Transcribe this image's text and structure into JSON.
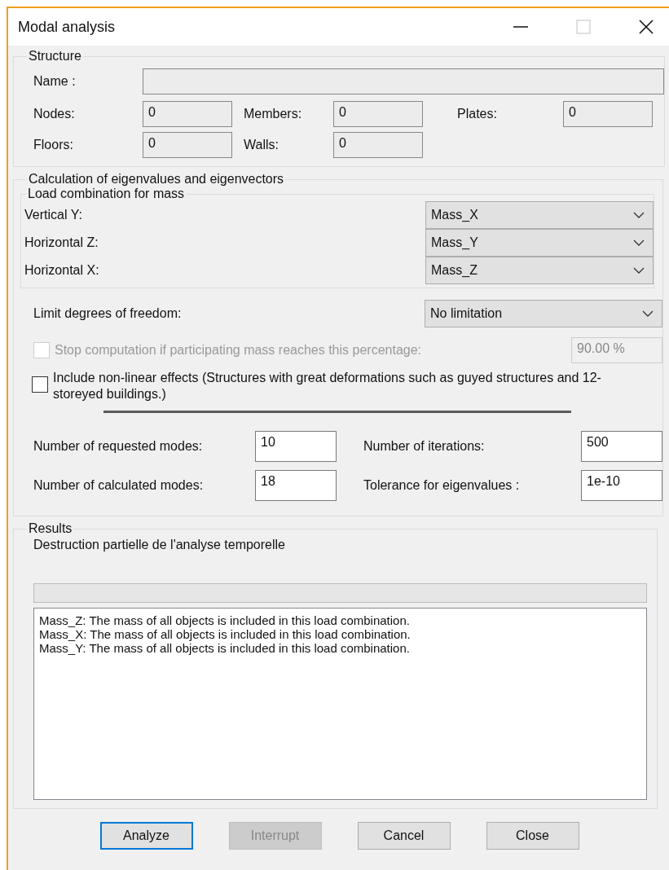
{
  "window": {
    "title": "Modal analysis"
  },
  "structure": {
    "title": "Structure",
    "name": {
      "label": "Name :"
    },
    "counts": [
      {
        "label": "Nodes:",
        "value": "0"
      },
      {
        "label": "Members:",
        "value": "0"
      },
      {
        "label": "Plates:",
        "value": "0"
      },
      {
        "label": "Floors:",
        "value": "0"
      },
      {
        "label": "Walls:",
        "value": "0"
      }
    ]
  },
  "calculation": {
    "title": "Calculation of eigenvalues and eigenvectors",
    "mass": {
      "title": "Load combination for mass",
      "rows": [
        {
          "label": "Vertical Y:",
          "value": "Mass_X"
        },
        {
          "label": "Horizontal Z:",
          "value": "Mass_Y"
        },
        {
          "label": "Horizontal X:",
          "value": "Mass_Z"
        }
      ]
    },
    "limit": {
      "label": "Limit degrees of freedom:",
      "value": "No limitation"
    },
    "stop": {
      "label": "Stop computation if participating mass reaches this percentage:",
      "checked": false,
      "disabled": true,
      "value": "90.00 %"
    },
    "nonlinear": {
      "label": "Include non-linear effects (Structures with great deformations such as guyed structures and 12-storeyed buildings.)",
      "checked": false
    },
    "params": [
      {
        "label": "Number of requested modes:",
        "value": "10"
      },
      {
        "label": "Number of iterations:",
        "value": "500"
      },
      {
        "label": "Number of calculated modes:",
        "value": "18"
      },
      {
        "label": "Tolerance for eigenvalues :",
        "value": "1e-10"
      }
    ]
  },
  "results": {
    "title": "Results",
    "message": "Destruction partielle de l'analyse temporelle",
    "progress": {
      "level": 0
    },
    "log": [
      "Mass_Z: The mass of all objects is included in this load combination.",
      "Mass_X: The mass of all objects is included in this load combination.",
      "Mass_Y: The mass of all objects is included in this load combination."
    ]
  },
  "buttons": [
    {
      "label": "Analyze",
      "disabled": false,
      "default": true
    },
    {
      "label": "Interrupt",
      "disabled": true,
      "default": false
    },
    {
      "label": "Cancel",
      "disabled": false,
      "default": false
    },
    {
      "label": "Close",
      "disabled": false,
      "default": false
    }
  ]
}
